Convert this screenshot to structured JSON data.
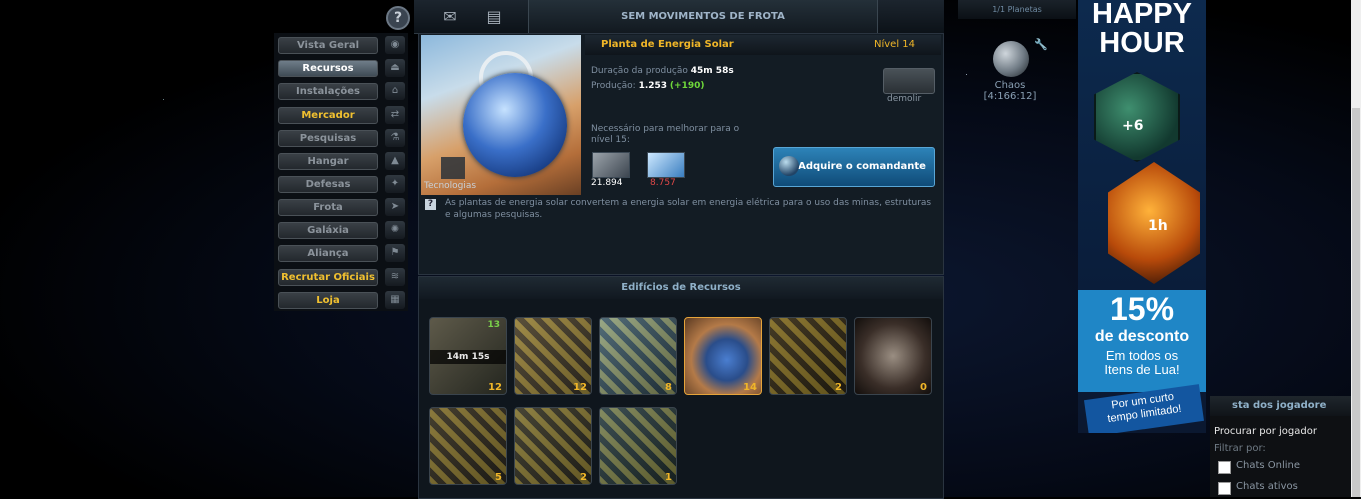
{
  "menu": {
    "items": [
      {
        "label": "Vista Geral",
        "style": "normal",
        "icon": "overview-icon"
      },
      {
        "label": "Recursos",
        "style": "selected",
        "icon": "resources-icon"
      },
      {
        "label": "Instalações",
        "style": "normal",
        "icon": "facilities-icon"
      },
      {
        "label": "Mercador",
        "style": "gold",
        "icon": "merchant-icon"
      },
      {
        "label": "Pesquisas",
        "style": "normal",
        "icon": "research-icon"
      },
      {
        "label": "Hangar",
        "style": "normal",
        "icon": "hangar-icon"
      },
      {
        "label": "Defesas",
        "style": "normal",
        "icon": "defense-icon"
      },
      {
        "label": "Frota",
        "style": "normal",
        "icon": "fleet-icon"
      },
      {
        "label": "Galáxia",
        "style": "normal",
        "icon": "galaxy-icon"
      },
      {
        "label": "Aliança",
        "style": "normal",
        "icon": "alliance-icon"
      },
      {
        "label": "Recrutar Oficiais",
        "style": "gold",
        "icon": "officers-icon"
      },
      {
        "label": "Loja",
        "style": "gold",
        "icon": "shop-icon"
      }
    ]
  },
  "topbar": {
    "fleet_status": "SEM MOVIMENTOS DE FROTA",
    "planets_count": "1/1 Planetas"
  },
  "detail": {
    "title": "Planta de Energia Solar",
    "level": "Nível 14",
    "tech_label": "Tecnologias",
    "duration_label": "Duração da produção",
    "duration_value": "45m 58s",
    "production_label": "Produção:",
    "production_value": "1.253",
    "production_delta": "(+190)",
    "demolish": "demolir",
    "upgrade_needed": "Necessário para melhorar para o nível 15:",
    "cost_metal": "21.894",
    "cost_crystal": "8.757",
    "commander_button": "Adquire o comandante",
    "description": "As plantas de energia solar convertem a energia solar em energia elétrica para o uso das minas, estruturas e algumas pesquisas."
  },
  "buildings": {
    "header": "Edifícios de Recursos",
    "slots": [
      {
        "level": "12",
        "timer": "14m 15s",
        "next": "13",
        "striped": false,
        "selected": false
      },
      {
        "level": "12",
        "striped": true,
        "selected": false
      },
      {
        "level": "8",
        "striped": true,
        "selected": false
      },
      {
        "level": "14",
        "striped": false,
        "selected": true
      },
      {
        "level": "2",
        "striped": true,
        "selected": false
      },
      {
        "level": "0",
        "striped": false,
        "selected": false
      },
      {
        "level": "5",
        "striped": true,
        "selected": false
      },
      {
        "level": "2",
        "striped": true,
        "selected": false
      },
      {
        "level": "1",
        "striped": true,
        "selected": false
      }
    ]
  },
  "planet": {
    "name": "Chaos",
    "coords": "[4:166:12]"
  },
  "banner": {
    "line1": "HAPPY",
    "line2": "HOUR",
    "badge1": "+6",
    "badge2": "1h",
    "discount": "15%",
    "discount_label": "de desconto",
    "items_line1": "Em todos os",
    "items_line2": "Itens de Lua!",
    "limited_line1": "Por um curto",
    "limited_line2": "tempo limitado!"
  },
  "players": {
    "header": "sta dos jogadore",
    "search": "Procurar por jogador",
    "filter": "Filtrar por:",
    "online": "Chats Online",
    "active": "Chats ativos"
  },
  "colors": {
    "gold": "#f0b628",
    "accent_blue": "#2d83b8",
    "green": "#6fd83a",
    "red": "#e04848"
  }
}
